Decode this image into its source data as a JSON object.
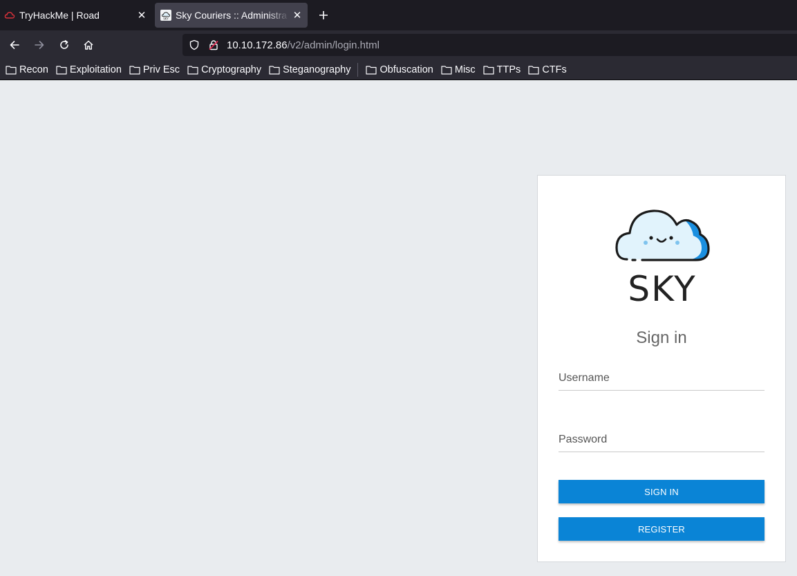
{
  "tabs": [
    {
      "title": "TryHackMe | Road",
      "favicon": "thm-cloud-icon"
    },
    {
      "title": "Sky Couriers :: Administra",
      "favicon": "sky-favicon"
    }
  ],
  "navigation": {
    "url_host": "10.10.172.86",
    "url_path": "/v2/admin/login.html"
  },
  "bookmarks": [
    "Recon",
    "Exploitation",
    "Priv Esc",
    "Cryptography",
    "Steganography",
    "Obfuscation",
    "Misc",
    "TTPs",
    "CTFs"
  ],
  "login": {
    "brand": "SKY",
    "title": "Sign in",
    "username_placeholder": "Username",
    "password_placeholder": "Password",
    "signin_label": "SIGN IN",
    "register_label": "REGISTER"
  },
  "colors": {
    "button": "#0a84d6",
    "page_background": "#e9ecef",
    "cloud_accent": "#1a8fe0"
  }
}
